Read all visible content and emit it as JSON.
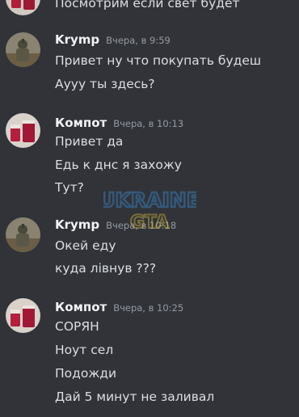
{
  "messages": {
    "prev_line": "Посмотрим если свет будет",
    "groups": [
      {
        "author": "Krymp",
        "time": "Вчера, в 9:59",
        "avatar": "soldier-avatar",
        "lines": [
          "Привет ну что покупать будеш",
          "Аууу ты здесь?"
        ]
      },
      {
        "author": "Компот",
        "time": "Вчера, в 10:13",
        "avatar": "drink-avatar",
        "lines": [
          "Привет да",
          "Едь к днс я захожу",
          "Тут?"
        ]
      },
      {
        "author": "Krymp",
        "time": "Вчера, в 10:18",
        "avatar": "soldier-avatar",
        "lines": [
          "Окей еду",
          "куда лівнув ???"
        ]
      },
      {
        "author": "Компот",
        "time": "Вчера, в 10:25",
        "avatar": "drink-avatar",
        "lines": [
          "СОРЯН",
          "Ноут сел",
          "Подожди",
          "Дай 5 минут не заливал"
        ]
      }
    ]
  },
  "watermark": {
    "line1": "UKRAINE",
    "line2": "GTA"
  },
  "colors": {
    "background": "#313338",
    "text": "#dbdee1",
    "author": "#f2f3f5",
    "timestamp": "#949ba4",
    "watermark": "#3a8fd6"
  }
}
